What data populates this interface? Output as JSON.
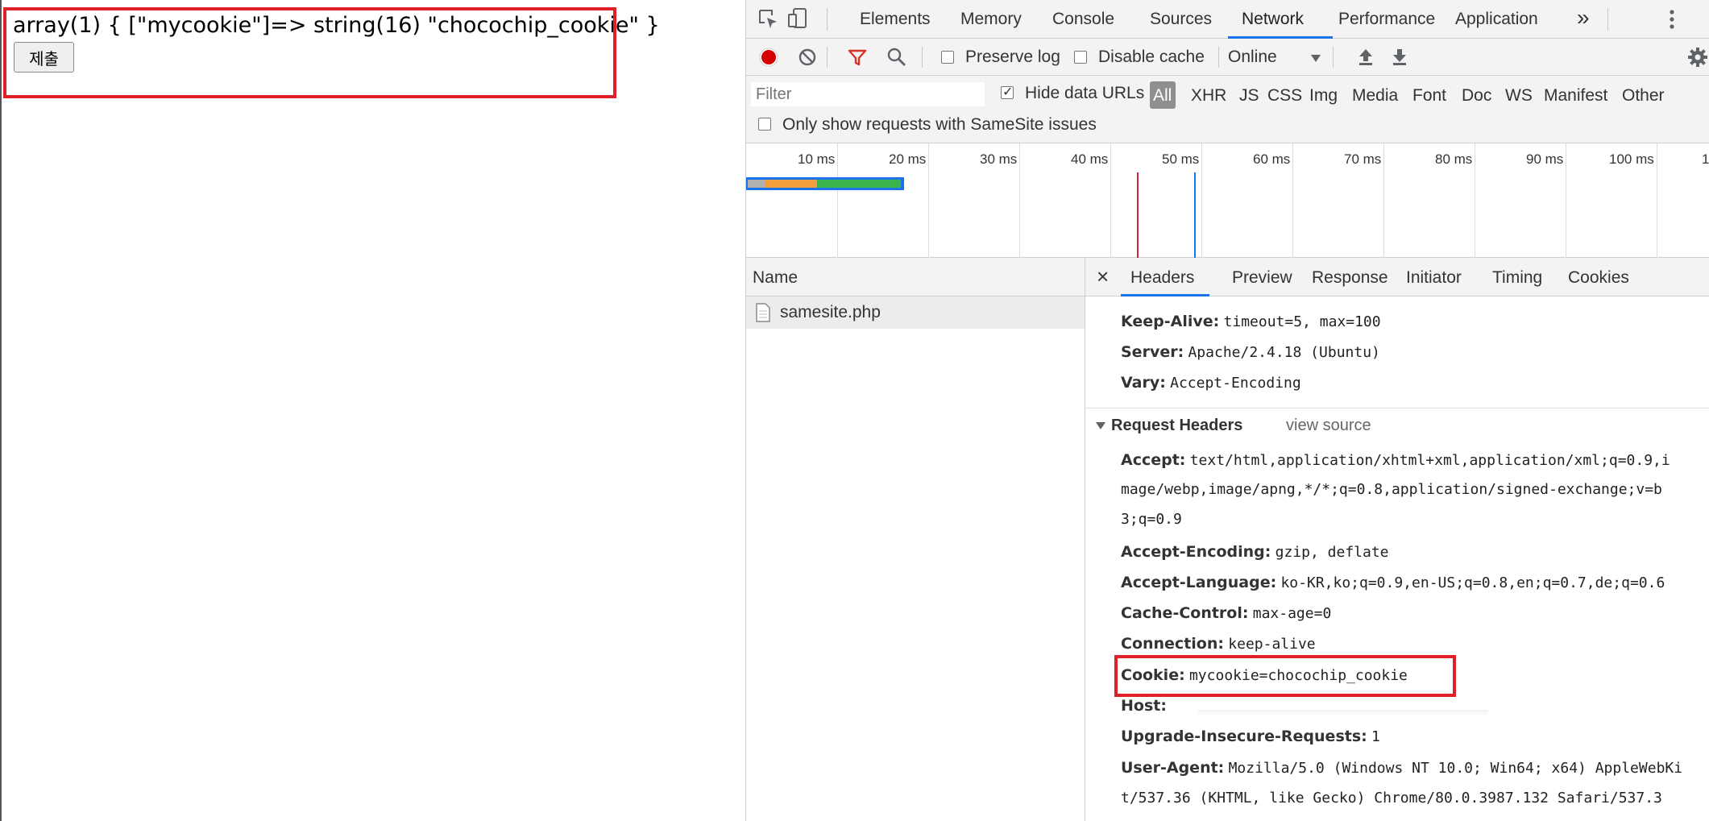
{
  "page": {
    "php_output": "array(1) { [\"mycookie\"]=> string(16) \"chocochip_cookie\" }",
    "submit_label": "제출"
  },
  "devtools": {
    "tabs": [
      "Elements",
      "Memory",
      "Console",
      "Sources",
      "Network",
      "Performance",
      "Application"
    ],
    "active_tab": "Network",
    "more_tabs_glyph": "»",
    "toolbar": {
      "preserve_log": "Preserve log",
      "disable_cache": "Disable cache",
      "throttling": "Online"
    },
    "filter": {
      "placeholder": "Filter",
      "hide_data_urls": "Hide data URLs",
      "types": [
        "All",
        "XHR",
        "JS",
        "CSS",
        "Img",
        "Media",
        "Font",
        "Doc",
        "WS",
        "Manifest",
        "Other"
      ],
      "samesite_label": "Only show requests with SameSite issues"
    },
    "timeline": {
      "ticks": [
        "10 ms",
        "20 ms",
        "30 ms",
        "40 ms",
        "50 ms",
        "60 ms",
        "70 ms",
        "80 ms",
        "90 ms",
        "100 ms",
        "1"
      ]
    },
    "name_panel": {
      "header": "Name",
      "rows": [
        "samesite.php"
      ]
    },
    "details": {
      "close_glyph": "×",
      "tabs": [
        "Headers",
        "Preview",
        "Response",
        "Initiator",
        "Timing",
        "Cookies"
      ],
      "response_headers": [
        {
          "key": "Keep-Alive:",
          "value": "timeout=5, max=100"
        },
        {
          "key": "Server:",
          "value": "Apache/2.4.18 (Ubuntu)"
        },
        {
          "key": "Vary:",
          "value": "Accept-Encoding"
        }
      ],
      "request_section": {
        "title": "Request Headers",
        "view_source": "view source"
      },
      "accept": {
        "key": "Accept:",
        "line1": "text/html,application/xhtml+xml,application/xml;q=0.9,i",
        "line2": "mage/webp,image/apng,*/*;q=0.8,application/signed-exchange;v=b",
        "line3": "3;q=0.9"
      },
      "request_headers": [
        {
          "key": "Accept-Encoding:",
          "value": "gzip, deflate"
        },
        {
          "key": "Accept-Language:",
          "value": "ko-KR,ko;q=0.9,en-US;q=0.8,en;q=0.7,de;q=0.6"
        },
        {
          "key": "Cache-Control:",
          "value": "max-age=0"
        },
        {
          "key": "Connection:",
          "value": "keep-alive"
        },
        {
          "key": "Cookie:",
          "value": "mycookie=chocochip_cookie"
        },
        {
          "key": "Host:",
          "value": ""
        },
        {
          "key": "Upgrade-Insecure-Requests:",
          "value": "1"
        }
      ],
      "user_agent": {
        "key": "User-Agent:",
        "line1": "Mozilla/5.0 (Windows NT 10.0; Win64; x64) AppleWebKi",
        "line2": "t/537.36 (KHTML, like Gecko) Chrome/80.0.3987.132 Safari/537.3"
      }
    }
  }
}
